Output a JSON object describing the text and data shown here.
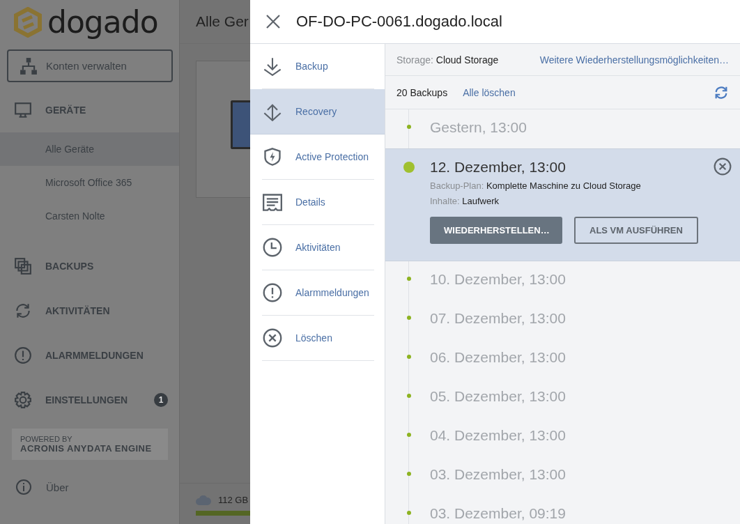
{
  "sidebar": {
    "logo": "dogado",
    "account_button": "Konten verwalten",
    "sections": [
      {
        "label": "GERÄTE",
        "children": [
          {
            "label": "Alle Geräte",
            "selected": true
          },
          {
            "label": "Microsoft Office 365",
            "selected": false
          },
          {
            "label": "Carsten Nolte",
            "selected": false
          }
        ]
      },
      {
        "label": "BACKUPS"
      },
      {
        "label": "AKTIVITÄTEN"
      },
      {
        "label": "ALARMMELDUNGEN"
      },
      {
        "label": "EINSTELLUNGEN",
        "badge": "1"
      }
    ],
    "powered_by": {
      "line_1": "POWERED BY",
      "line_2": "ACRONIS ANYDATA ENGINE"
    },
    "about": "Über"
  },
  "background": {
    "title": "Alle Ger",
    "storage": "112 GB"
  },
  "panel": {
    "title": "OF-DO-PC-0061.dogado.local",
    "nav": [
      {
        "label": "Backup",
        "selected": false
      },
      {
        "label": "Recovery",
        "selected": true
      },
      {
        "label": "Active Protection",
        "selected": false
      },
      {
        "label": "Details",
        "selected": false
      },
      {
        "label": "Aktivitäten",
        "selected": false
      },
      {
        "label": "Alarmmeldungen",
        "selected": false
      },
      {
        "label": "Löschen",
        "selected": false
      }
    ],
    "storage_label": "Storage:",
    "storage_value": "Cloud Storage",
    "more_link": "Weitere Wiederherstellungsmöglichkeiten…",
    "count": "20 Backups",
    "delete_all": "Alle löschen",
    "backups": [
      {
        "date": "Gestern, 13:00",
        "selected": false
      },
      {
        "date": "12. Dezember, 13:00",
        "selected": true,
        "details": [
          {
            "label": "Backup-Plan:",
            "value": "Komplette Maschine zu Cloud Storage"
          },
          {
            "label": "Inhalte:",
            "value": "Laufwerk"
          }
        ],
        "buttons": [
          {
            "label": "WIEDERHERSTELLEN…",
            "kind": "primary"
          },
          {
            "label": "ALS VM AUSFÜHREN",
            "kind": "secondary"
          }
        ]
      },
      {
        "date": "10. Dezember, 13:00",
        "selected": false
      },
      {
        "date": "07. Dezember, 13:00",
        "selected": false
      },
      {
        "date": "06. Dezember, 13:00",
        "selected": false
      },
      {
        "date": "05. Dezember, 13:00",
        "selected": false
      },
      {
        "date": "04. Dezember, 13:00",
        "selected": false
      },
      {
        "date": "03. Dezember, 13:00",
        "selected": false
      },
      {
        "date": "03. Dezember, 09:19",
        "selected": false
      }
    ]
  }
}
